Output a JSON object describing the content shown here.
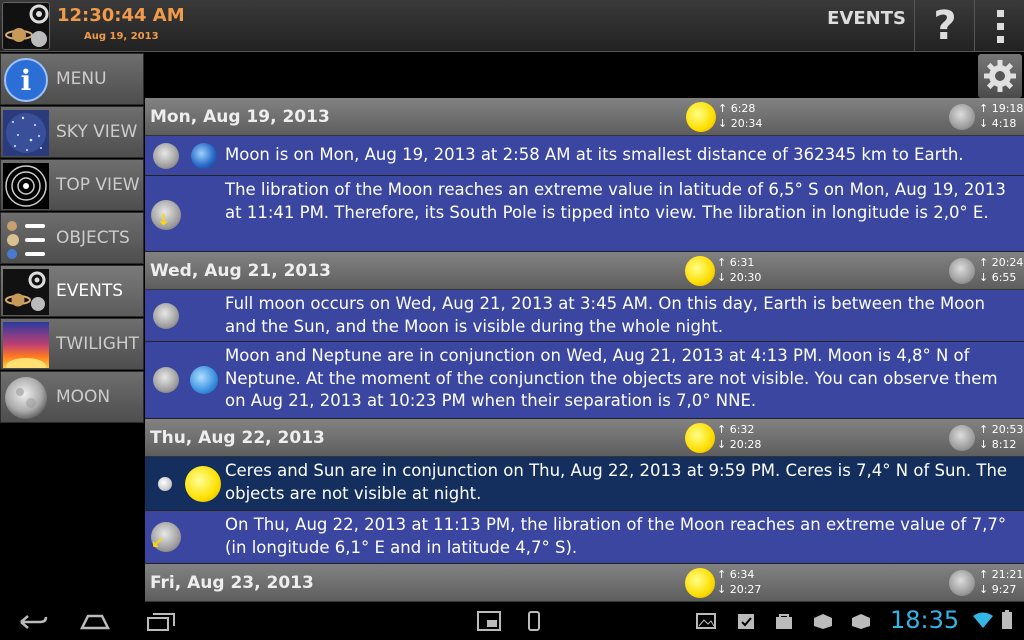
{
  "header": {
    "clock": "12:30:44 AM",
    "date": "Aug 19, 2013",
    "title": "EVENTS",
    "help_label": "?"
  },
  "sidebar": {
    "items": [
      {
        "label": "MENU",
        "icon": "info-icon"
      },
      {
        "label": "SKY VIEW",
        "icon": "sky-view-icon"
      },
      {
        "label": "TOP VIEW",
        "icon": "orbits-icon"
      },
      {
        "label": "OBJECTS",
        "icon": "objects-icon"
      },
      {
        "label": "EVENTS",
        "icon": "events-icon",
        "active": true
      },
      {
        "label": "TWILIGHT",
        "icon": "twilight-icon"
      },
      {
        "label": "MOON",
        "icon": "moon-icon"
      }
    ]
  },
  "days": [
    {
      "label": "Mon, Aug 19, 2013",
      "sun_rise": "↑ 6:28",
      "sun_set": "↓ 20:34",
      "moon_rise": "↑ 19:18",
      "moon_set": "↓ 4:18",
      "events": [
        {
          "text": "Moon is on Mon, Aug 19, 2013 at 2:58 AM at its smallest distance of 362345 km to Earth."
        },
        {
          "text": "The libration of the Moon reaches an extreme value in latitude of 6,5° S on Mon, Aug 19, 2013 at 11:41 PM. Therefore, its South Pole is tipped into view. The libration in longitude is 2,0° E."
        }
      ]
    },
    {
      "label": "Wed, Aug 21, 2013",
      "sun_rise": "↑ 6:31",
      "sun_set": "↓ 20:30",
      "moon_rise": "↑ 20:24",
      "moon_set": "↓ 6:55",
      "events": [
        {
          "text": "Full moon occurs on Wed, Aug 21, 2013 at 3:45 AM. On this day, Earth is between the Moon and the Sun, and the Moon is visible during the whole night."
        },
        {
          "text": "Moon and Neptune are in conjunction on Wed, Aug 21, 2013 at 4:13 PM. Moon is 4,8° N of Neptune. At the moment of the conjunction the objects are not visible. You can observe them on Aug 21, 2013 at 10:23 PM when their separation is 7,0° NNE."
        }
      ]
    },
    {
      "label": "Thu, Aug 22, 2013",
      "sun_rise": "↑ 6:32",
      "sun_set": "↓ 20:28",
      "moon_rise": "↑ 20:53",
      "moon_set": "↓ 8:12",
      "events": [
        {
          "text": "Ceres and Sun are in conjunction on Thu, Aug 22, 2013 at 9:59 PM. Ceres is 7,4° N of Sun. The objects are not visible at night."
        },
        {
          "text": "On Thu, Aug 22, 2013 at 11:13 PM, the libration of the Moon reaches an extreme value of 7,7° (in longitude 6,1° E and in latitude 4,7° S)."
        }
      ]
    },
    {
      "label": "Fri, Aug 23, 2013",
      "sun_rise": "↑ 6:34",
      "sun_set": "↓ 20:27",
      "moon_rise": "↑ 21:21",
      "moon_set": "↓ 9:27",
      "events": []
    }
  ],
  "statusbar": {
    "time": "18:35"
  },
  "colors": {
    "accent_orange": "#f29a4c",
    "event_blue": "#3a46a0",
    "event_dark_blue": "#142e5e",
    "status_time": "#33b5e5"
  }
}
